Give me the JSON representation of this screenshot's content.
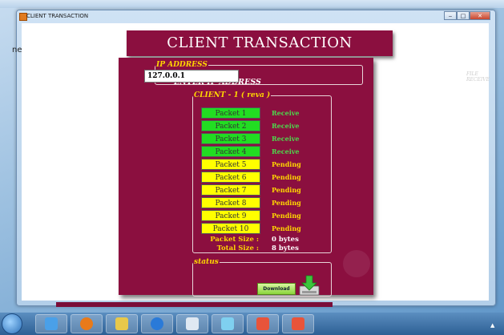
{
  "window": {
    "title": "CLIENT TRANSACTION",
    "controls": {
      "minimize": "‒",
      "maximize": "□",
      "close": "✕"
    },
    "edge_glyph": "ne"
  },
  "header": {
    "title": "CLIENT TRANSACTION",
    "side_label": "FILE RECEIVE"
  },
  "ip_section": {
    "legend": "IP ADDRESS",
    "label": "ENTER IP ADDRESS",
    "value": "127.0.0.1"
  },
  "client_section": {
    "legend": "CLIENT - 1 ( reva )",
    "packets": [
      {
        "label": "Packet 1",
        "status": "Receive",
        "state": "received"
      },
      {
        "label": "Packet 2",
        "status": "Receive",
        "state": "received"
      },
      {
        "label": "Packet 3",
        "status": "Receive",
        "state": "received"
      },
      {
        "label": "Packet 4",
        "status": "Receive",
        "state": "received"
      },
      {
        "label": "Packet 5",
        "status": "Pending",
        "state": "pending"
      },
      {
        "label": "Packet 6",
        "status": "Pending",
        "state": "pending"
      },
      {
        "label": "Packet 7",
        "status": "Pending",
        "state": "pending"
      },
      {
        "label": "Packet 8",
        "status": "Pending",
        "state": "pending"
      },
      {
        "label": "Packet 9",
        "status": "Pending",
        "state": "pending"
      },
      {
        "label": "Packet 10",
        "status": "Pending",
        "state": "pending"
      }
    ],
    "packet_size_label": "Packet Size :",
    "packet_size_value": "0 bytes",
    "total_size_label": "Total Size :",
    "total_size_value": "8 bytes"
  },
  "status_section": {
    "legend": "status",
    "download_label": "Download"
  },
  "colors": {
    "panel": "#8b0f3f",
    "received": "#22dd22",
    "pending": "#ffff00",
    "legend": "#ffd700"
  },
  "taskbar": {
    "items": [
      "start-orb",
      "media-player-icon",
      "firefox-icon",
      "file-explorer-icon",
      "internet-explorer-icon",
      "notepad-icon",
      "windows-live-icon",
      "java-app-icon",
      "java-app-icon"
    ]
  }
}
